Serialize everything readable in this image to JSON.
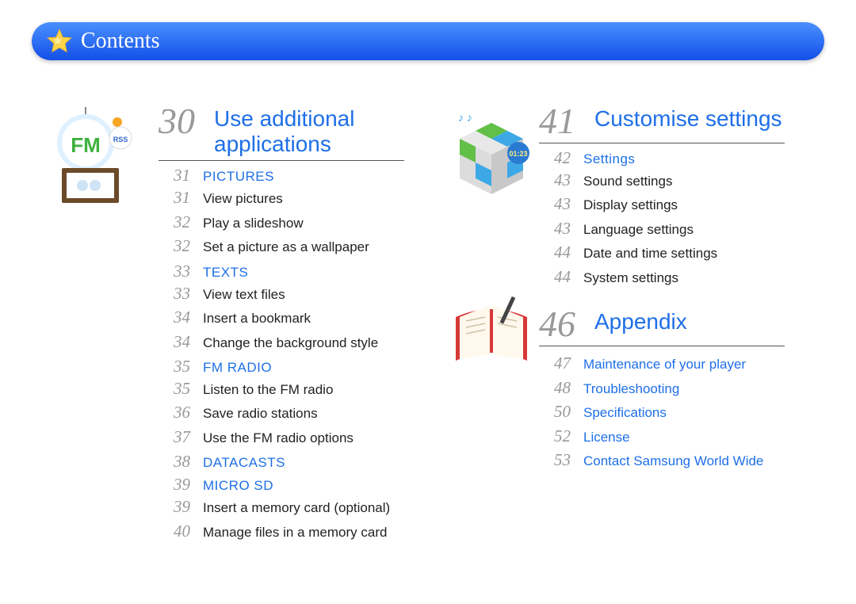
{
  "header": {
    "title": "Contents"
  },
  "left": {
    "section_num": "30",
    "section_title": "Use additional applications",
    "groups": [
      {
        "num": "31",
        "title": "PICTURES",
        "items": [
          {
            "num": "31",
            "text": "View pictures"
          },
          {
            "num": "32",
            "text": "Play a slideshow"
          },
          {
            "num": "32",
            "text": "Set a picture as a wallpaper"
          }
        ]
      },
      {
        "num": "33",
        "title": "TEXTS",
        "items": [
          {
            "num": "33",
            "text": "View text files"
          },
          {
            "num": "34",
            "text": "Insert a bookmark"
          },
          {
            "num": "34",
            "text": "Change the background style"
          }
        ]
      },
      {
        "num": "35",
        "title": "FM RADIO",
        "items": [
          {
            "num": "35",
            "text": "Listen to the FM radio"
          },
          {
            "num": "36",
            "text": "Save radio stations"
          },
          {
            "num": "37",
            "text": "Use the FM radio options"
          }
        ]
      },
      {
        "num": "38",
        "title": "DATACASTS",
        "items": []
      },
      {
        "num": "39",
        "title": "MICRO SD",
        "items": [
          {
            "num": "39",
            "text": "Insert a memory card (optional)"
          },
          {
            "num": "40",
            "text": "Manage files in a memory card"
          }
        ]
      }
    ]
  },
  "right": {
    "sections": [
      {
        "num": "41",
        "title": "Customise settings",
        "groups": [
          {
            "num": "42",
            "title": "Settings",
            "items": [
              {
                "num": "43",
                "text": "Sound settings"
              },
              {
                "num": "43",
                "text": "Display settings"
              },
              {
                "num": "43",
                "text": "Language settings"
              },
              {
                "num": "44",
                "text": "Date and time settings"
              },
              {
                "num": "44",
                "text": "System settings"
              }
            ]
          }
        ]
      },
      {
        "num": "46",
        "title": "Appendix",
        "blue_items": [
          {
            "num": "47",
            "text": "Maintenance of your player"
          },
          {
            "num": "48",
            "text": "Troubleshooting"
          },
          {
            "num": "50",
            "text": "Specifications"
          },
          {
            "num": "52",
            "text": "License"
          },
          {
            "num": "53",
            "text": "Contact Samsung World Wide"
          }
        ]
      }
    ]
  }
}
